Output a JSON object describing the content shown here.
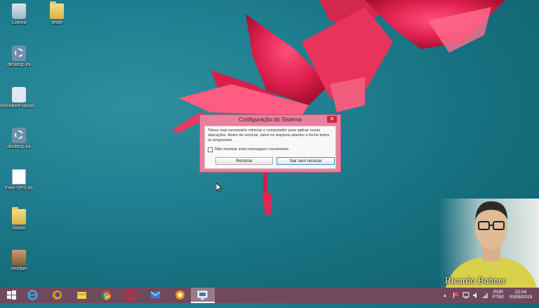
{
  "desktop": {
    "icons": [
      {
        "label": "Lixeira",
        "icon": "recycle-bin-icon"
      },
      {
        "label": "teste",
        "icon": "folder-icon"
      },
      {
        "label": "desktop.ini",
        "icon": "settings-file-icon"
      },
      {
        "label": "ReceberFotosd...",
        "icon": "application-icon"
      },
      {
        "label": "desktop.ini",
        "icon": "settings-file-icon"
      },
      {
        "label": "Free VPS.txt",
        "icon": "text-file-icon"
      },
      {
        "label": "Notas",
        "icon": "folder-icon"
      },
      {
        "label": "receber",
        "icon": "application-icon"
      }
    ]
  },
  "dialog": {
    "title": "Configuração do Sistema",
    "close": "✕",
    "message": "Talvez seja necessário reiniciar o computador para aplicar essas alterações. Antes de reiniciar, salve os arquivos abertos e feche todos os programas.",
    "checkbox_label": "Não mostrar esta mensagem novamente.",
    "restart_label": "Reiniciar",
    "exit_label": "Sair sem reiniciar"
  },
  "webcam": {
    "name": "Ricardo Bohner"
  },
  "taskbar": {
    "apps": [
      "start-icon",
      "internet-explorer-icon",
      "firefox-icon",
      "file-explorer-icon",
      "chrome-icon",
      "opera-icon",
      "mail-icon",
      "app-icon",
      "system-configuration-icon"
    ],
    "language": "POR",
    "keyboard": "PTB2",
    "time": "22:04",
    "date": "03/08/2019"
  },
  "colors": {
    "dialog_frame": "#ea7f9e",
    "taskbar": "#784659",
    "desktop": "#1f7f90"
  }
}
